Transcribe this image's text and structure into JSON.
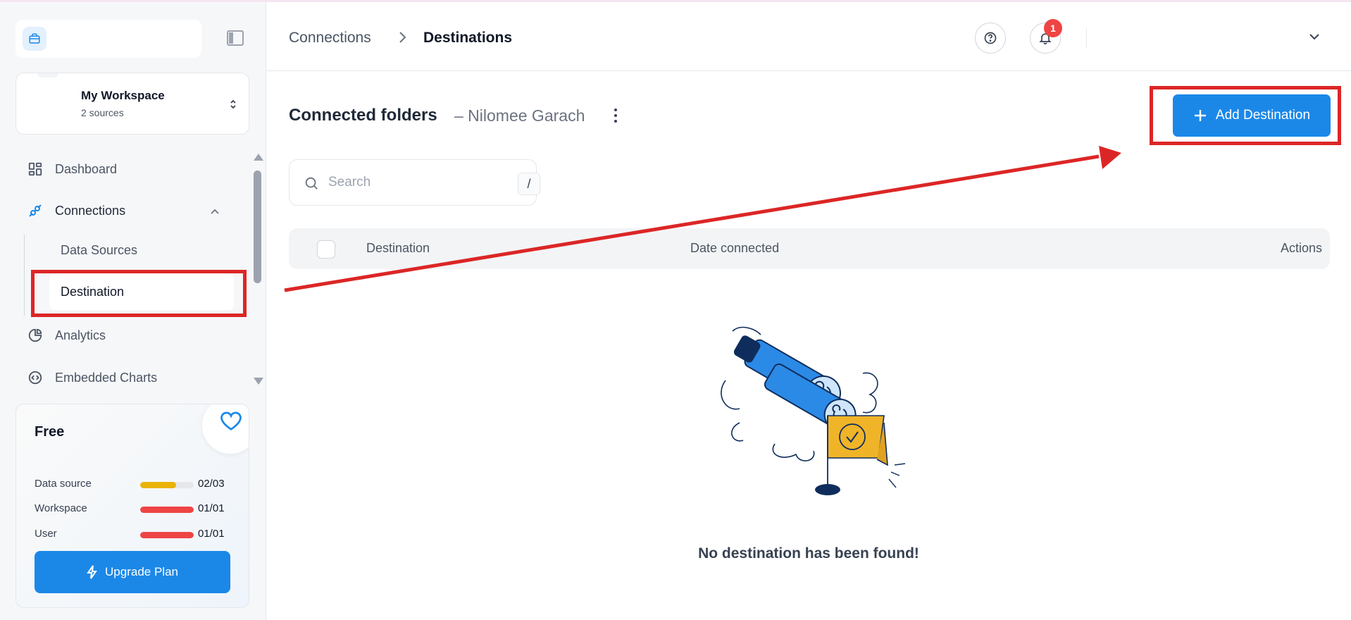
{
  "sidebar": {
    "workspace": {
      "name": "My Workspace",
      "sources": "2 sources"
    },
    "nav": {
      "dashboard": "Dashboard",
      "connections": "Connections",
      "data_sources": "Data Sources",
      "destination": "Destination",
      "analytics": "Analytics",
      "embedded_charts": "Embedded Charts"
    },
    "plan": {
      "title": "Free",
      "rows": [
        {
          "label": "Data source",
          "value": "02/03",
          "fill": 0.67,
          "color": "#eab308"
        },
        {
          "label": "Workspace",
          "value": "01/01",
          "fill": 1.0,
          "color": "#ef4444"
        },
        {
          "label": "User",
          "value": "01/01",
          "fill": 1.0,
          "color": "#ef4444"
        }
      ],
      "upgrade_label": "Upgrade Plan"
    }
  },
  "header": {
    "breadcrumb": {
      "parent": "Connections",
      "current": "Destinations"
    },
    "notification_count": "1"
  },
  "main": {
    "title": "Connected folders",
    "subtitle": "– Nilomee Garach",
    "add_button": "Add Destination",
    "search": {
      "placeholder": "Search",
      "shortcut": "/"
    },
    "table": {
      "columns": [
        "Destination",
        "Date connected",
        "Actions"
      ]
    },
    "empty_message": "No destination has been found!"
  },
  "colors": {
    "accent": "#1b88e8",
    "annotation": "#dc2626"
  }
}
